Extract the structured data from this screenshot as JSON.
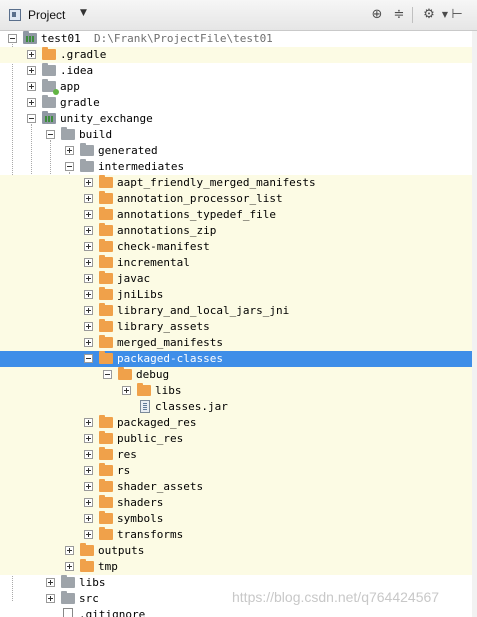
{
  "panel": {
    "title": "Project",
    "dropdown_icon": "chevron-down-icon",
    "toolbar_icons": [
      "target-icon",
      "collapse-all-icon",
      "gear-icon",
      "hide-panel-icon"
    ]
  },
  "tree": {
    "root_label": "test01",
    "root_path": "D:\\Frank\\ProjectFile\\test01",
    "items": [
      "test01",
      ".gradle",
      ".idea",
      "app",
      "gradle",
      "unity_exchange",
      "build",
      "generated",
      "intermediates",
      "aapt_friendly_merged_manifests",
      "annotation_processor_list",
      "annotations_typedef_file",
      "annotations_zip",
      "check-manifest",
      "incremental",
      "javac",
      "jniLibs",
      "library_and_local_jars_jni",
      "library_assets",
      "merged_manifests",
      "packaged-classes",
      "debug",
      "libs",
      "classes.jar",
      "packaged_res",
      "public_res",
      "res",
      "rs",
      "shader_assets",
      "shaders",
      "symbols",
      "transforms",
      "outputs",
      "tmp",
      "libs",
      "src",
      ".gitignore"
    ],
    "selected_item": "packaged-classes"
  },
  "watermark": "https://blog.csdn.net/q764424567",
  "colors": {
    "selection": "#3e8ee8",
    "row_shade": "#fcfbe4",
    "folder_orange": "#f0a14a",
    "folder_gray": "#9ea4aa"
  }
}
